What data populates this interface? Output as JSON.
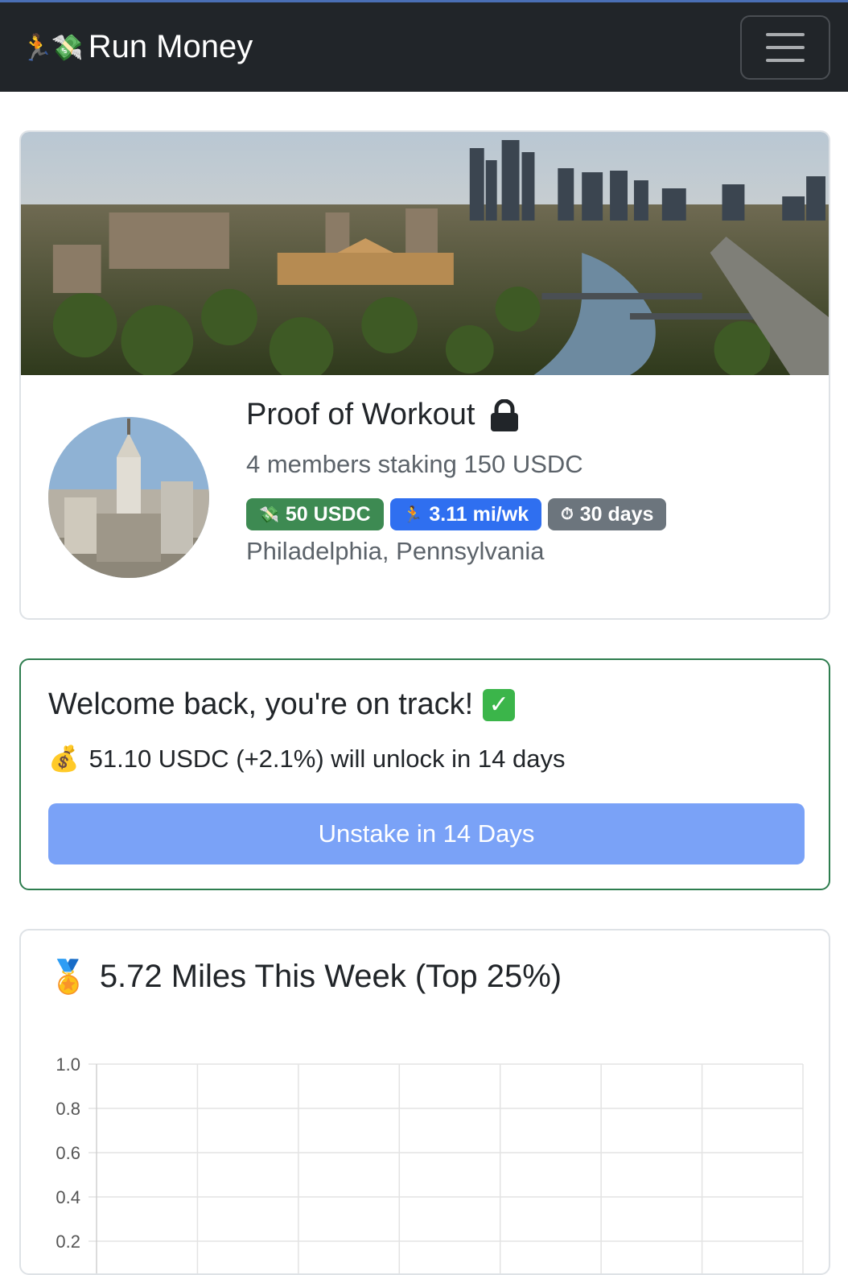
{
  "nav": {
    "brand_icons": "🏃💸",
    "brand_text": "Run Money"
  },
  "group": {
    "title": "Proof of Workout",
    "lock_icon": "lock-icon",
    "subtitle": "4 members staking 150 USDC",
    "badges": [
      {
        "icon": "💸",
        "label": "50 USDC",
        "color": "#3d8a52"
      },
      {
        "icon": "🏃",
        "label": "3.11 mi/wk",
        "color": "#2f6ff0"
      },
      {
        "icon": "⏱",
        "label": "30 days",
        "color": "#6c757d"
      }
    ],
    "location": "Philadelphia, Pennsylvania"
  },
  "status": {
    "heading": "Welcome back, you're on track!",
    "check_icon": "✓",
    "unlock_icon": "💰",
    "unlock_text": "51.10 USDC (+2.1%) will unlock in 14 days",
    "button_label": "Unstake in 14 Days"
  },
  "weekly": {
    "medal_icon": "🏅",
    "heading": "5.72 Miles This Week (Top 25%)"
  },
  "chart_data": {
    "type": "line",
    "ylim": [
      0,
      1.0
    ],
    "yticks": [
      "1.0",
      "0.8",
      "0.6",
      "0.4",
      "0.2"
    ],
    "grid": true,
    "series": []
  }
}
